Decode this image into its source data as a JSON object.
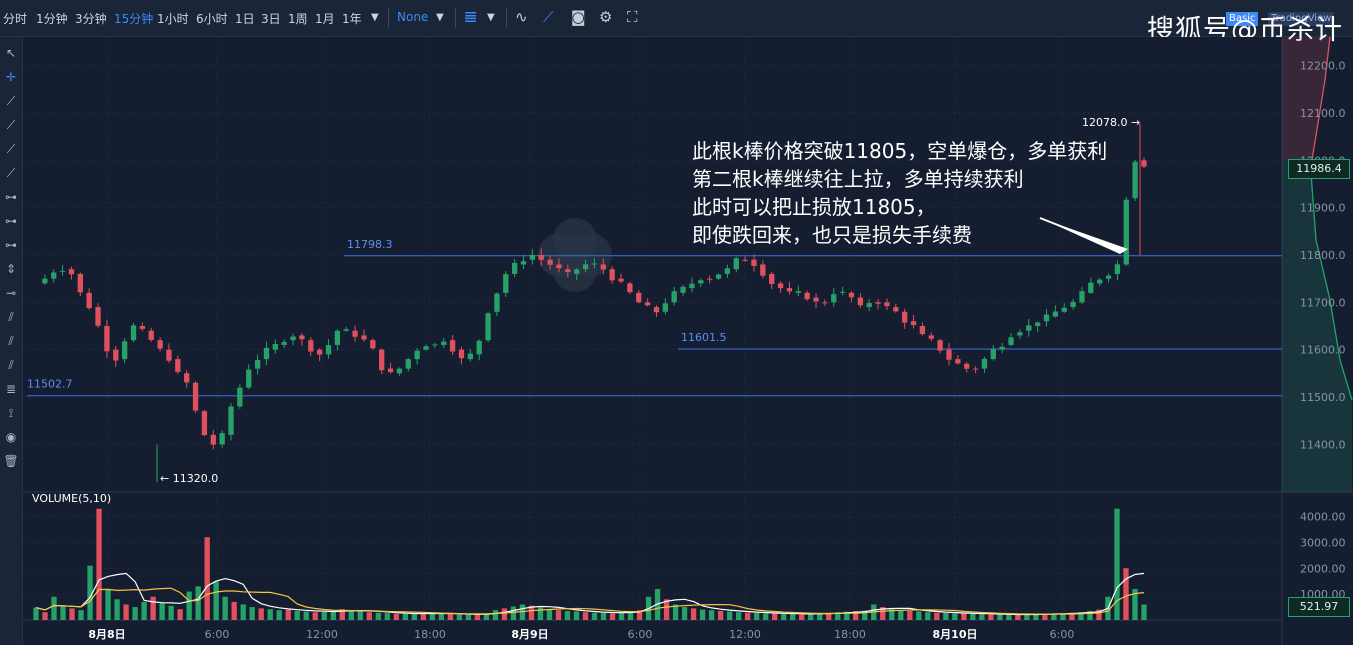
{
  "toolbar": {
    "intervals": [
      "分时",
      "1分钟",
      "3分钟",
      "15分钟",
      "1小时",
      "6小时",
      "1日",
      "3日",
      "1周",
      "1月",
      "1年"
    ],
    "active_interval": "15分钟",
    "indicator_select": "None"
  },
  "top_right_buttons": [
    "Basic",
    "TradingView"
  ],
  "watermark": "搜狐号@币杀计",
  "annotation": {
    "lines": [
      "此根k棒价格突破11805，空单爆仓，多单获利",
      "第二根k棒继续往上拉，多单持续获利",
      "此时可以把止损放11805，",
      "即使跌回来，也只是损失手续费"
    ]
  },
  "price_axis": [
    "12200.0",
    "12100.0",
    "12000.0",
    "11900.0",
    "11800.0",
    "11700.0",
    "11600.0",
    "11500.0",
    "11400.0"
  ],
  "current_price": "11986.4",
  "volume_axis": [
    "4000.00",
    "3000.00",
    "2000.00",
    "1000.00"
  ],
  "current_volume": "521.97",
  "volume_label": "VOLUME(5,10)",
  "time_axis": [
    "8月8日",
    "6:00",
    "12:00",
    "18:00",
    "8月9日",
    "6:00",
    "12:00",
    "18:00",
    "8月10日",
    "6:00"
  ],
  "levels": [
    {
      "label": "11798.3",
      "price": 11798.3
    },
    {
      "label": "11601.5",
      "price": 11601.5
    },
    {
      "label": "11502.7",
      "price": 11502.7
    }
  ],
  "high_label": "12078.0 →",
  "low_label": "← 11320.0",
  "colors": {
    "up": "#26a269",
    "down": "#e0515e",
    "level": "#3d6fe0",
    "accent": "#3d8af7"
  },
  "chart_data": {
    "type": "candlestick",
    "ylim": [
      11300,
      12240
    ],
    "x_time_labels": [
      "8月8日",
      "6:00",
      "12:00",
      "18:00",
      "8月9日",
      "6:00",
      "12:00",
      "18:00",
      "8月10日",
      "6:00"
    ],
    "price_path": [
      11740,
      11750,
      11765,
      11770,
      11760,
      11720,
      11690,
      11650,
      11600,
      11580,
      11620,
      11650,
      11640,
      11620,
      11600,
      11580,
      11550,
      11530,
      11470,
      11420,
      11400,
      11420,
      11480,
      11520,
      11560,
      11580,
      11600,
      11610,
      11620,
      11630,
      11620,
      11600,
      11590,
      11610,
      11640,
      11640,
      11630,
      11620,
      11600,
      11560,
      11550,
      11560,
      11580,
      11600,
      11610,
      11610,
      11620,
      11600,
      11580,
      11590,
      11620,
      11680,
      11720,
      11760,
      11780,
      11790,
      11800,
      11790,
      11780,
      11770,
      11760,
      11770,
      11780,
      11780,
      11770,
      11750,
      11740,
      11720,
      11700,
      11690,
      11680,
      11700,
      11720,
      11730,
      11740,
      11750,
      11750,
      11760,
      11770,
      11790,
      11790,
      11780,
      11760,
      11740,
      11730,
      11720,
      11720,
      11710,
      11700,
      11700,
      11720,
      11720,
      11710,
      11690,
      11700,
      11700,
      11690,
      11680,
      11660,
      11650,
      11630,
      11620,
      11600,
      11580,
      11570,
      11560,
      11560,
      11580,
      11600,
      11610,
      11630,
      11640,
      11650,
      11660,
      11670,
      11680,
      11690,
      11700,
      11720,
      11740,
      11750,
      11760,
      11780,
      11920,
      12000,
      11990
    ],
    "volumes": [
      480,
      300,
      900,
      520,
      450,
      380,
      2100,
      4300,
      1200,
      800,
      600,
      500,
      700,
      900,
      650,
      550,
      420,
      1100,
      1300,
      3200,
      1500,
      900,
      700,
      600,
      500,
      450,
      420,
      380,
      400,
      350,
      330,
      300,
      320,
      350,
      420,
      380,
      340,
      300,
      280,
      260,
      240,
      230,
      250,
      280,
      260,
      240,
      230,
      210,
      200,
      220,
      240,
      380,
      450,
      520,
      600,
      550,
      480,
      420,
      380,
      350,
      330,
      300,
      280,
      270,
      260,
      300,
      340,
      380,
      900,
      1200,
      800,
      600,
      500,
      450,
      400,
      380,
      350,
      330,
      300,
      280,
      270,
      260,
      250,
      240,
      230,
      220,
      240,
      260,
      280,
      300,
      320,
      340,
      360,
      600,
      500,
      420,
      380,
      350,
      330,
      300,
      280,
      270,
      260,
      250,
      240,
      230,
      220,
      210,
      200,
      210,
      220,
      230,
      240,
      250,
      260,
      280,
      300,
      350,
      400,
      900,
      4300,
      2000,
      1200,
      600
    ]
  }
}
